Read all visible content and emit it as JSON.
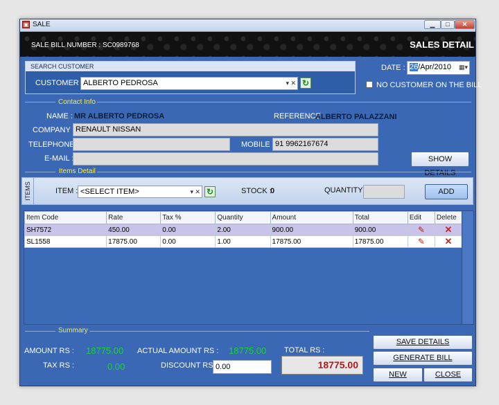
{
  "window": {
    "title": "SALE",
    "icon": "app-icon"
  },
  "header": {
    "bill_label": "SALE BILL NUMBER :",
    "bill_number": "SC0989768",
    "page_title": "SALES DETAIL"
  },
  "search": {
    "header": "SEARCH CUSTOMER",
    "customer_label": "CUSTOMER :",
    "customer_value": "ALBERTO PEDROSA"
  },
  "date": {
    "label": "DATE :",
    "day": "26",
    "rest": "/Apr/2010"
  },
  "no_customer_label": "NO CUSTOMER ON THE BILL",
  "contact": {
    "section_title": "Contact Info",
    "name_label": "NAME :",
    "name_value": "MR ALBERTO PEDROSA",
    "reference_label": "REFERENCE",
    "reference_value": "ALBERTO  PALAZZANI",
    "company_label": "COMPANY :",
    "company_value": "RENAULT NISSAN",
    "telephone_label": "TELEPHONE :",
    "telephone_value": "",
    "mobile_label": "MOBILE :",
    "mobile_value": "91 9962167674",
    "email_label": "E-MAIL :",
    "email_value": "",
    "show_details_button": "SHOW DETAILS"
  },
  "items_detail": {
    "section_title": "Items Detail",
    "tab_label": "ITEMS",
    "item_label": "ITEM :",
    "item_value": "<SELECT ITEM>",
    "stock_label": "STOCK :",
    "stock_value": "0",
    "quantity_label": "QUANTITY :",
    "quantity_value": "",
    "add_button": "ADD"
  },
  "grid": {
    "columns": [
      "Item Code",
      "Rate",
      "Tax %",
      "Quantity",
      "Amount",
      "Total",
      "Edit",
      "Delete"
    ],
    "rows": [
      [
        "SH7572",
        "450.00",
        "0.00",
        "2.00",
        "900.00",
        "900.00"
      ],
      [
        "SL1558",
        "17875.00",
        "0.00",
        "1.00",
        "17875.00",
        "17875.00"
      ]
    ]
  },
  "summary": {
    "section_title": "Summary",
    "amount_label": "AMOUNT RS :",
    "amount_value": "18775.00",
    "actual_amount_label": "ACTUAL AMOUNT RS :",
    "actual_amount_value": "18775.00",
    "total_label": "TOTAL RS :",
    "total_value": "18775.00",
    "tax_label": "TAX RS :",
    "tax_value": "0.00",
    "discount_label": "DISCOUNT RS :",
    "discount_value": "0.00"
  },
  "actions": {
    "save": "SAVE DETAILS",
    "generate": "GENERATE BILL",
    "new": "NEW",
    "close": "CLOSE"
  }
}
